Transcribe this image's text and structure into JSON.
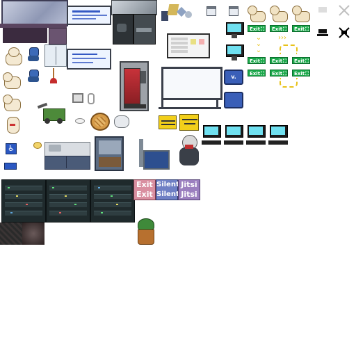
{
  "tileset": {
    "version_badge": "v. 0.6",
    "labels": {
      "exit": "Exit",
      "silent": "Silent",
      "jitsi": "Jitsi"
    },
    "exit_signs": [
      "Exit",
      "Exit",
      "Exit",
      "Exit",
      "Exit",
      "Exit",
      "Exit",
      "Exit",
      "Exit"
    ],
    "colors": {
      "exit_green": "#1aa84a",
      "exit_pink": "#d98fa0",
      "silent_blue": "#6e7fc4",
      "jitsi_purple": "#9b7fbf",
      "monitor_cyan": "#6fe0f0",
      "sign_yellow": "#f2cf1a"
    },
    "icons": [
      "desk-icon",
      "whiteboard-icon",
      "coffee-machine-icon",
      "dog-icon",
      "chair-icon",
      "fridge-icon",
      "vending-machine-icon",
      "computer-monitor-icon",
      "calendar-icon",
      "no-signal-icon",
      "wheelchair-icon",
      "plant-icon",
      "server-rack-icon",
      "person-icon",
      "sink-icon",
      "bulletin-board-icon"
    ]
  }
}
